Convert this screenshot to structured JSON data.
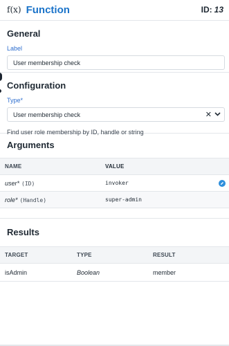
{
  "header": {
    "icon": "f(x)",
    "title": "Function",
    "id_label": "ID:",
    "id_value": "13"
  },
  "general": {
    "title": "General",
    "label_field": {
      "label": "Label",
      "value": "User membership check"
    }
  },
  "configuration": {
    "title": "Configuration",
    "type_field": {
      "label": "Type*",
      "value": "User membership check",
      "clear_glyph": "✕",
      "chevron_glyph": "⌄"
    },
    "help_text": "Find user role membership by ID, handle or string"
  },
  "arguments": {
    "title": "Arguments",
    "columns": [
      "NAME",
      "VALUE"
    ],
    "rows": [
      {
        "name": "user*",
        "type": "(ID)",
        "value": "invoker",
        "edit_icon": "pencil-icon"
      },
      {
        "name": "role*",
        "type": "(Handle)",
        "value": "super-admin"
      }
    ]
  },
  "results": {
    "title": "Results",
    "columns": [
      "TARGET",
      "TYPE",
      "RESULT"
    ],
    "rows": [
      {
        "target": "isAdmin",
        "type": "Boolean",
        "result": "member"
      }
    ]
  },
  "colors": {
    "accent": "#1a73c9",
    "label_blue": "#2f6fcf",
    "edit_badge": "#2f8fdc"
  }
}
